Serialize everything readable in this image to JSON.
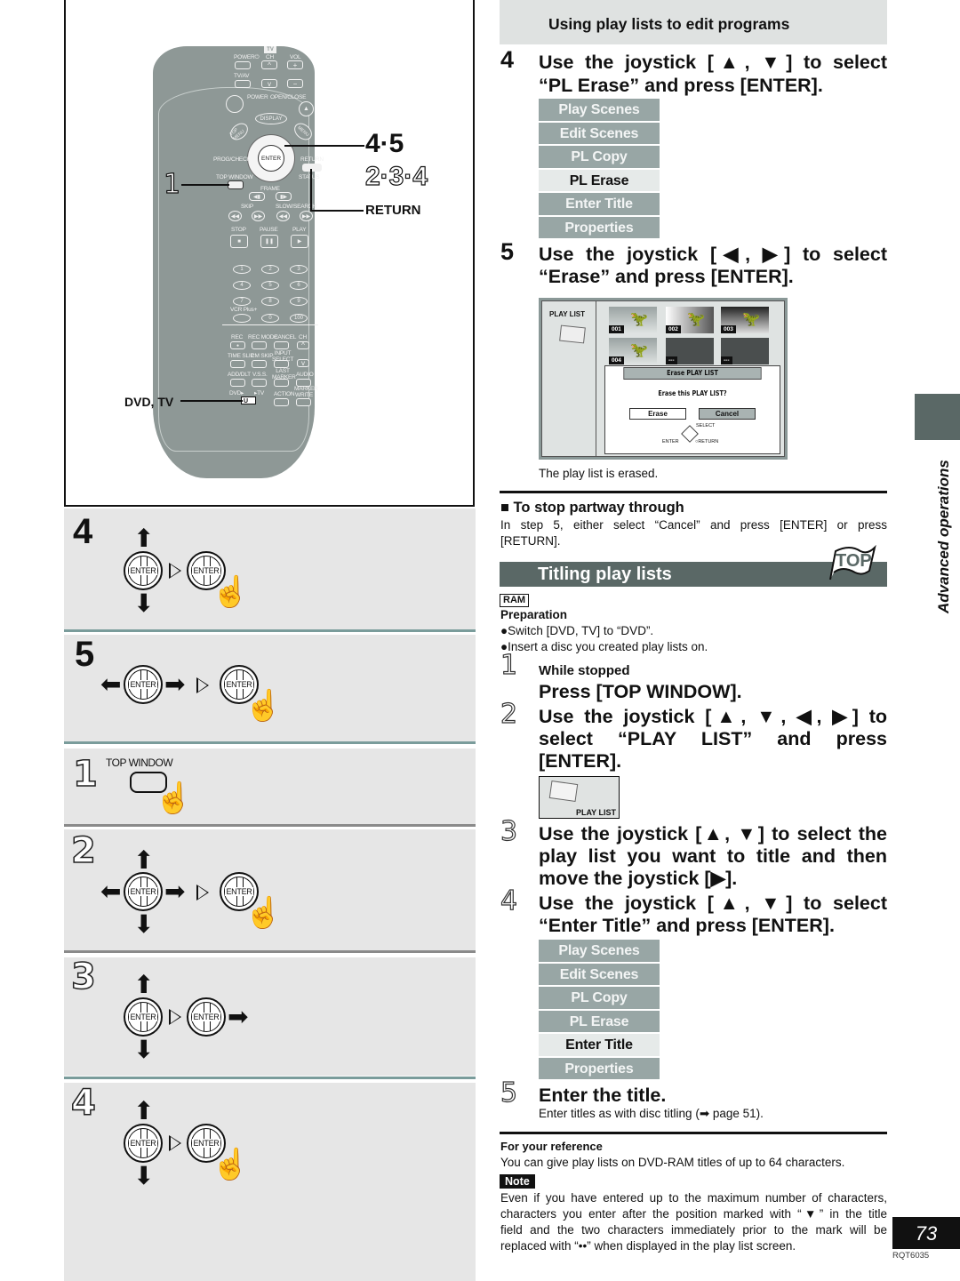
{
  "left": {
    "remote": {
      "tv_label": "TV",
      "labels": {
        "power_tv": "POWER⏻",
        "ch": "CH",
        "vol": "VOL",
        "tvav": "TV/AV",
        "power": "POWER",
        "open_close": "OPEN/CLOSE",
        "direct_navigator": "DIRECT NAVIGATOR",
        "display": "DISPLAY",
        "play_list": "PLAY LIST",
        "top_menu": "TOP MENU",
        "menu": "MENU",
        "prog_check": "PROG/CHECK",
        "enter": "ENTER",
        "return": "RETURN",
        "top_window": "TOP WINDOW",
        "status": "STATUS",
        "frame": "FRAME",
        "skip": "SKIP",
        "slow_search": "SLOW/SEARCH",
        "stop": "STOP",
        "pause": "PAUSE",
        "play": "PLAY",
        "vcr_plus": "VCR Plus+",
        "rec": "REC",
        "rec_mode": "REC MODE",
        "cancel": "CANCEL",
        "dvd_ch": "DVD",
        "ch2": "CH",
        "time_slip": "TIME SLIP",
        "cm_skip": "CM SKIP",
        "input_select": "INPUT SELECT",
        "add_dlt": "ADD/DLT",
        "vss": "V.S.S.",
        "last_marker": "LAST MARKER",
        "audio": "AUDIO",
        "dvd_switch": "DVD▸",
        "tv_switch": "▸TV",
        "action": "ACTION",
        "marker_write": "MARKER WRITE"
      },
      "numbers": [
        "1",
        "2",
        "3",
        "4",
        "5",
        "6",
        "7",
        "8",
        "9",
        "0",
        "100"
      ]
    },
    "callouts": {
      "steps_a": "4·5",
      "steps_b": "2·3·4",
      "return": "RETURN",
      "step1": "1",
      "dvd_tv": "DVD, TV"
    },
    "panels": [
      {
        "step": "4",
        "style": "bold",
        "caption": ""
      },
      {
        "step": "5",
        "style": "bold",
        "caption": ""
      },
      {
        "step": "1",
        "style": "outline",
        "caption": "TOP WINDOW"
      },
      {
        "step": "2",
        "style": "outline",
        "caption": ""
      },
      {
        "step": "3",
        "style": "outline",
        "caption": ""
      },
      {
        "step": "4",
        "style": "outline",
        "caption": ""
      }
    ],
    "enter_label": "ENTER"
  },
  "right": {
    "section_header": "Using play lists to edit programs",
    "erase_steps": [
      {
        "num": "4",
        "lines": [
          "Use the joystick [▲, ▼] to select",
          "“PL Erase” and press [ENTER]."
        ]
      },
      {
        "num": "5",
        "lines": [
          "Use the joystick [◀, ▶] to select",
          "“Erase” and press [ENTER]."
        ]
      }
    ],
    "menu1": {
      "items": [
        "Play Scenes",
        "Edit Scenes",
        "PL Copy",
        "PL Erase",
        "Enter Title",
        "Properties"
      ],
      "selected": "PL Erase"
    },
    "screen": {
      "side_label": "PLAY LIST",
      "thumbs": [
        "001",
        "002",
        "003",
        "004",
        "---",
        "---"
      ],
      "dialog_title": "Erase PLAY LIST",
      "dialog_question": "Erase this PLAY LIST?",
      "erase_btn": "Erase",
      "cancel_btn": "Cancel",
      "hint_select": "SELECT",
      "hint_enter": "ENTER",
      "hint_return": "RETURN"
    },
    "erased_note": "The play list is erased.",
    "stop_heading": "■ To stop partway through",
    "stop_text_1": "In step 5, either select “Cancel” and press [ENTER] or press",
    "stop_text_2": "[RETURN].",
    "titling_header": "Titling play lists",
    "top_flag": "TOP",
    "ram_badge": "RAM",
    "preparation_heading": "Preparation",
    "preparation_items": [
      "●Switch [DVD, TV] to “DVD”.",
      "●Insert a disc you created play lists on."
    ],
    "title_steps": {
      "s1_num": "1",
      "s1_sub": "While stopped",
      "s1_main": "Press [TOP WINDOW].",
      "s2_num": "2",
      "s2_lines": [
        "Use the joystick [▲, ▼, ◀, ▶] to",
        "select “PLAY LIST” and press",
        "[ENTER]."
      ],
      "s2_icon_label": "PLAY LIST",
      "s3_num": "3",
      "s3_lines": [
        "Use the joystick [▲, ▼] to select the",
        "play list you want to title and then",
        "move the joystick [▶]."
      ],
      "s4_num": "4",
      "s4_lines": [
        "Use the joystick [▲, ▼] to select",
        "“Enter Title” and press [ENTER]."
      ],
      "s5_num": "5",
      "s5_main": "Enter the title.",
      "s5_sub": "Enter titles as with disc titling (➡ page 51)."
    },
    "menu2": {
      "items": [
        "Play Scenes",
        "Edit Scenes",
        "PL Copy",
        "PL Erase",
        "Enter Title",
        "Properties"
      ],
      "selected": "Enter Title"
    },
    "reference_heading": "For your reference",
    "reference_text": "You can give play lists on DVD-RAM titles of up to 64 characters.",
    "note_badge": "Note",
    "note_lines": [
      "Even if you have entered up to the maximum number of characters,",
      "characters you enter after the position marked with “▼” in the title",
      "field and the two characters immediately prior to the mark will be",
      "replaced with “••” when displayed in the play list screen."
    ]
  },
  "side_tab": {
    "label": "Advanced operations",
    "page_number": "73",
    "doc_code": "RQT6035",
    "color": "#5a6866"
  },
  "colors": {
    "menu_item": "#98a6a5",
    "menu_selected": "#e6eae9",
    "section_bar": "#5a6866",
    "panel_bg": "#e6e6e6",
    "remote_body": "#8e9896"
  }
}
